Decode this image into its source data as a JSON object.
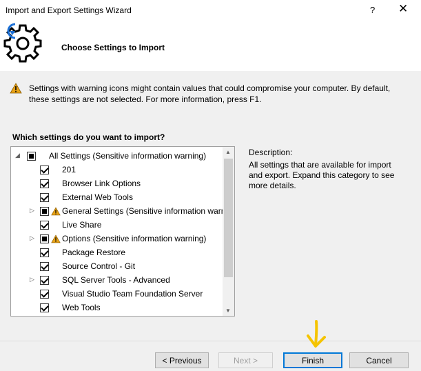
{
  "window": {
    "title": "Import and Export Settings Wizard",
    "help_glyph": "?",
    "close_glyph": "✕"
  },
  "header": {
    "icon": "gear-import-icon",
    "title": "Choose Settings to Import",
    "accent_color": "#1a6fd6"
  },
  "warning": {
    "icon": "warning-icon",
    "text": "Settings with warning icons might contain values that could compromise your computer. By default, these settings are not selected. For more information, press F1."
  },
  "question": "Which settings do you want to import?",
  "tree": {
    "items": [
      {
        "label": "All Settings (Sensitive information warning)",
        "state": "partial",
        "expander": "◢",
        "warning": false
      },
      {
        "label": "201",
        "state": "checked",
        "expander": "",
        "warning": false
      },
      {
        "label": "Browser Link Options",
        "state": "checked",
        "expander": "",
        "warning": false
      },
      {
        "label": "External Web Tools",
        "state": "checked",
        "expander": "",
        "warning": false
      },
      {
        "label": "General Settings (Sensitive information warn",
        "state": "partial",
        "expander": "▷",
        "warning": true
      },
      {
        "label": "Live Share",
        "state": "checked",
        "expander": "",
        "warning": false
      },
      {
        "label": "Options (Sensitive information warning)",
        "state": "partial",
        "expander": "▷",
        "warning": true
      },
      {
        "label": "Package Restore",
        "state": "checked",
        "expander": "",
        "warning": false
      },
      {
        "label": "Source Control - Git",
        "state": "checked",
        "expander": "",
        "warning": false
      },
      {
        "label": "SQL Server Tools - Advanced",
        "state": "checked",
        "expander": "▷",
        "warning": false
      },
      {
        "label": "Visual Studio Team Foundation Server",
        "state": "checked",
        "expander": "",
        "warning": false
      },
      {
        "label": "Web Tools",
        "state": "checked",
        "expander": "",
        "warning": false
      }
    ],
    "scroll_up_glyph": "▲",
    "scroll_down_glyph": "▼"
  },
  "description": {
    "heading": "Description:",
    "body": "All settings that are available for import and export. Expand this category to see more details."
  },
  "buttons": {
    "previous": "< Previous",
    "next": "Next >",
    "finish": "Finish",
    "cancel": "Cancel"
  },
  "annotation": {
    "icon": "arrow-down-icon",
    "color": "#f5c400"
  }
}
